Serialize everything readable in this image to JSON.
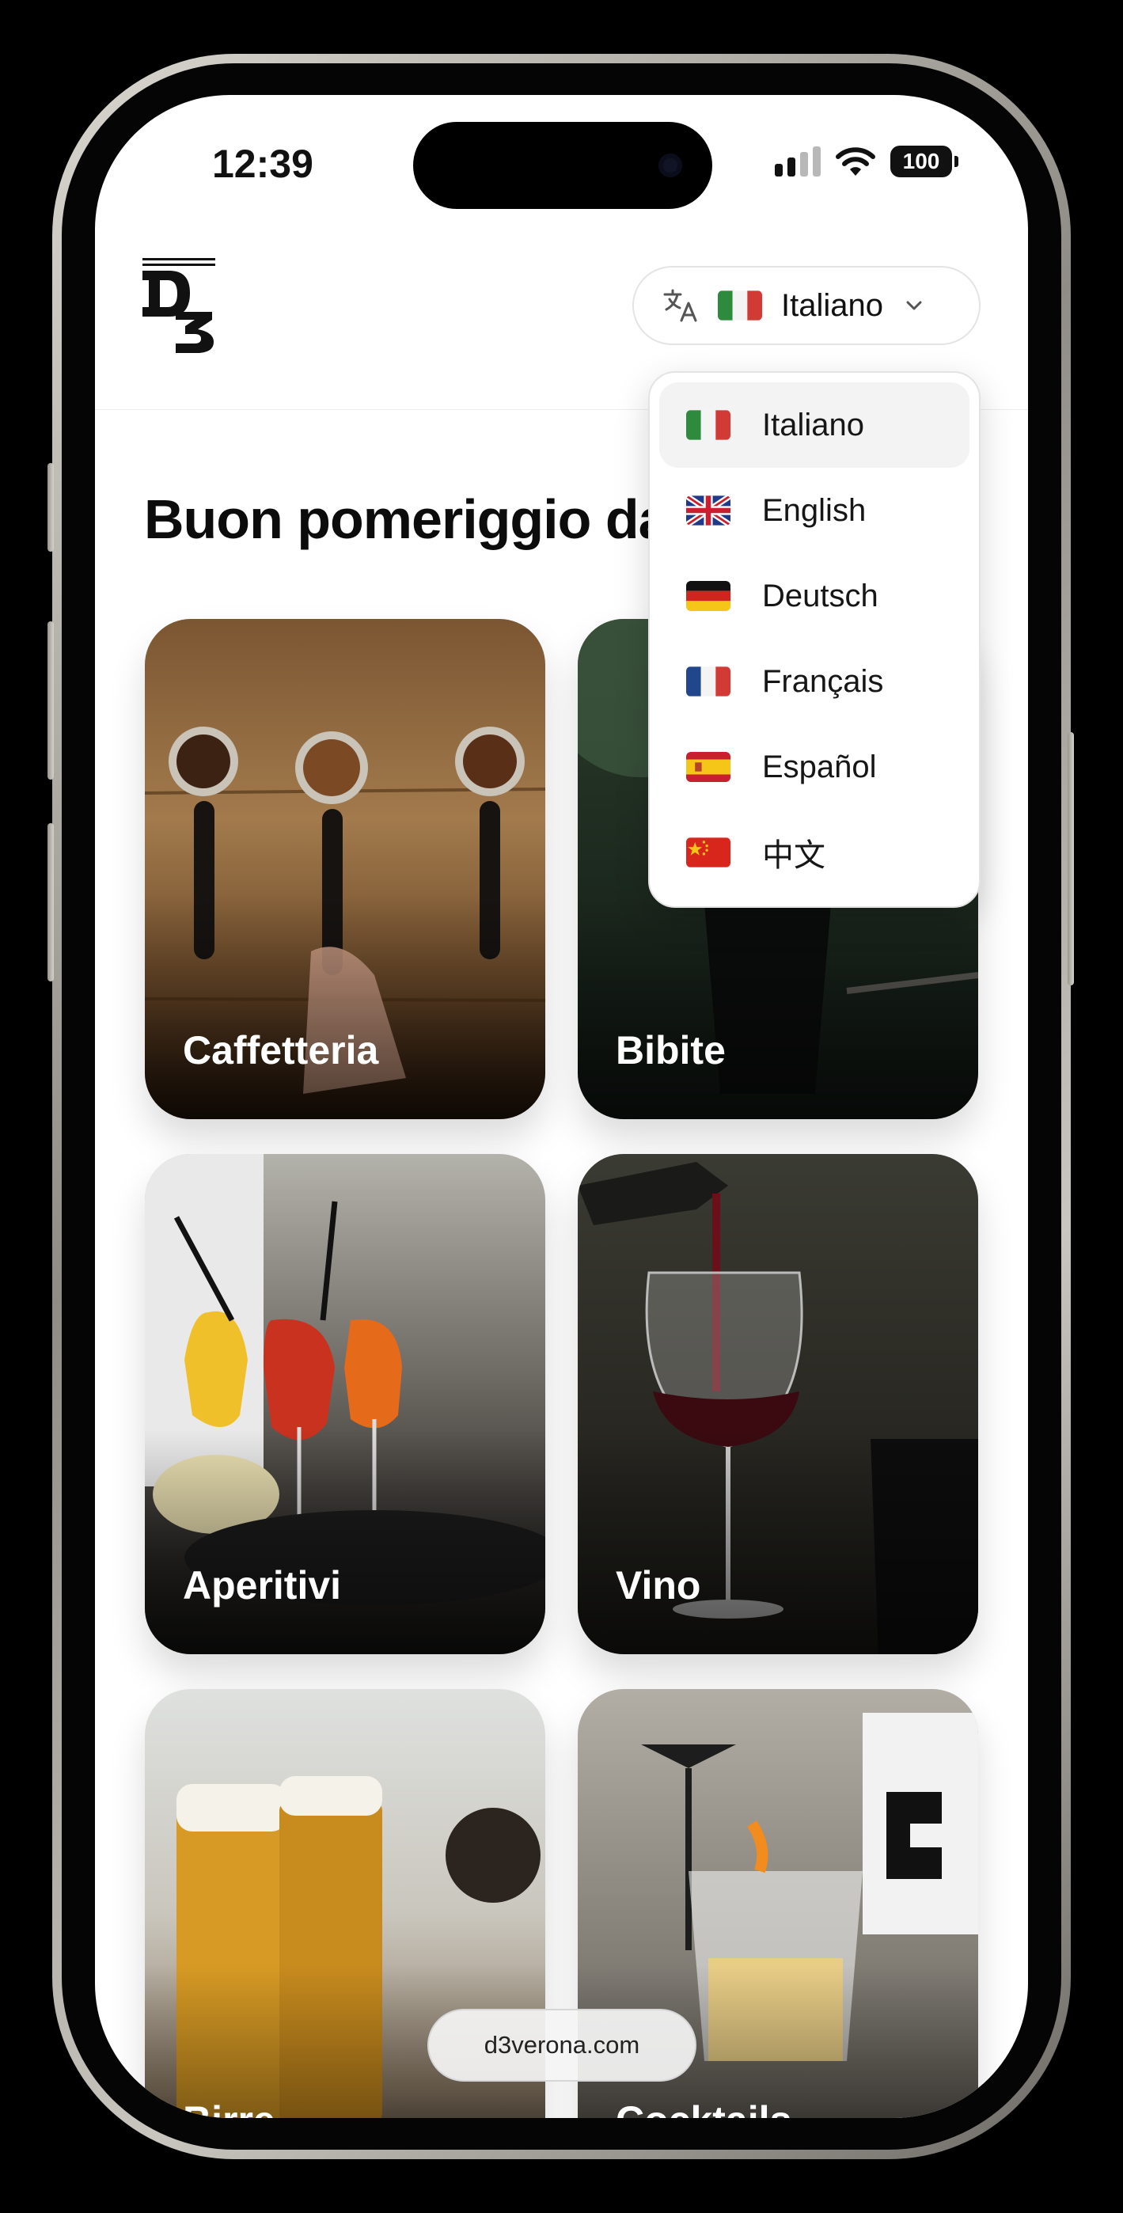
{
  "status_bar": {
    "time": "12:39",
    "battery": "100"
  },
  "header": {
    "language_button": {
      "label": "Italiano",
      "flag": "it"
    }
  },
  "greeting": "Buon pomeriggio da",
  "categories": [
    {
      "label": "Caffetteria"
    },
    {
      "label": "Bibite"
    },
    {
      "label": "Aperitivi"
    },
    {
      "label": "Vino"
    },
    {
      "label": "Birre"
    },
    {
      "label": "Cocktails"
    }
  ],
  "url_bar": {
    "text": "d3verona.com"
  },
  "language_menu": {
    "items": [
      {
        "label": "Italiano",
        "flag": "it",
        "selected": true
      },
      {
        "label": "English",
        "flag": "gb"
      },
      {
        "label": "Deutsch",
        "flag": "de"
      },
      {
        "label": "Français",
        "flag": "fr"
      },
      {
        "label": "Español",
        "flag": "es"
      },
      {
        "label": "中文",
        "flag": "cn"
      }
    ]
  },
  "colors": {
    "accent": "#111111",
    "dropdown_selected_bg": "#f3f3f3"
  }
}
